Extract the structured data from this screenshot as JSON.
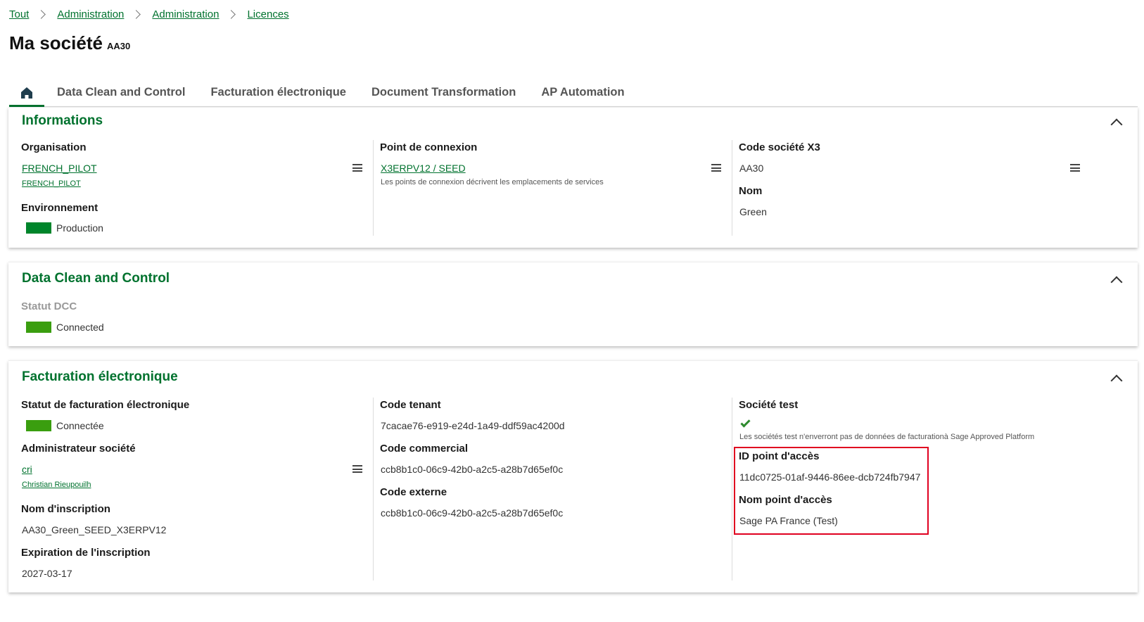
{
  "breadcrumb": [
    "Tout",
    "Administration",
    "Administration",
    "Licences"
  ],
  "page": {
    "title": "Ma société",
    "code": "AA30"
  },
  "tabs": [
    "Data Clean and Control",
    "Facturation électronique",
    "Document Transformation",
    "AP Automation"
  ],
  "colors": {
    "accent": "#00722e",
    "production": "#00852b",
    "connected": "#3a9e0f",
    "highlight": "#e00020"
  },
  "informations": {
    "title": "Informations",
    "organisation_label": "Organisation",
    "organisation_value": "FRENCH_PILOT",
    "organisation_sub": "FRENCH_PILOT",
    "environnement_label": "Environnement",
    "environnement_value": "Production",
    "point_label": "Point de connexion",
    "point_value": "X3ERPV12 / SEED",
    "point_hint": "Les points de connexion décrivent les emplacements de services",
    "code_label": "Code société X3",
    "code_value": "AA30",
    "nom_label": "Nom",
    "nom_value": "Green"
  },
  "dcc": {
    "title": "Data Clean and Control",
    "statut_label": "Statut DCC",
    "statut_value": "Connected"
  },
  "facturation": {
    "title": "Facturation électronique",
    "statut_label": "Statut de facturation électronique",
    "statut_value": "Connectée",
    "admin_label": "Administrateur société",
    "admin_value": "cri",
    "admin_sub": "Christian Rieupouilh",
    "inscription_label": "Nom d'inscription",
    "inscription_value": "AA30_Green_SEED_X3ERPV12",
    "expiration_label": "Expiration de l'inscription",
    "expiration_value": "2027-03-17",
    "tenant_label": "Code tenant",
    "tenant_value": "7cacae76-e919-e24d-1a49-ddf59ac4200d",
    "commercial_label": "Code commercial",
    "commercial_value": "ccb8b1c0-06c9-42b0-a2c5-a28b7d65ef0c",
    "externe_label": "Code externe",
    "externe_value": "ccb8b1c0-06c9-42b0-a2c5-a28b7d65ef0c",
    "test_label": "Société test",
    "test_hint": "Les sociétés test n'enverront pas de données de facturationà Sage Approved Platform",
    "id_label": "ID point d'accès",
    "id_value": "11dc0725-01af-9446-86ee-dcb724fb7947",
    "nom_point_label": "Nom point d'accès",
    "nom_point_value": "Sage PA France (Test)"
  }
}
